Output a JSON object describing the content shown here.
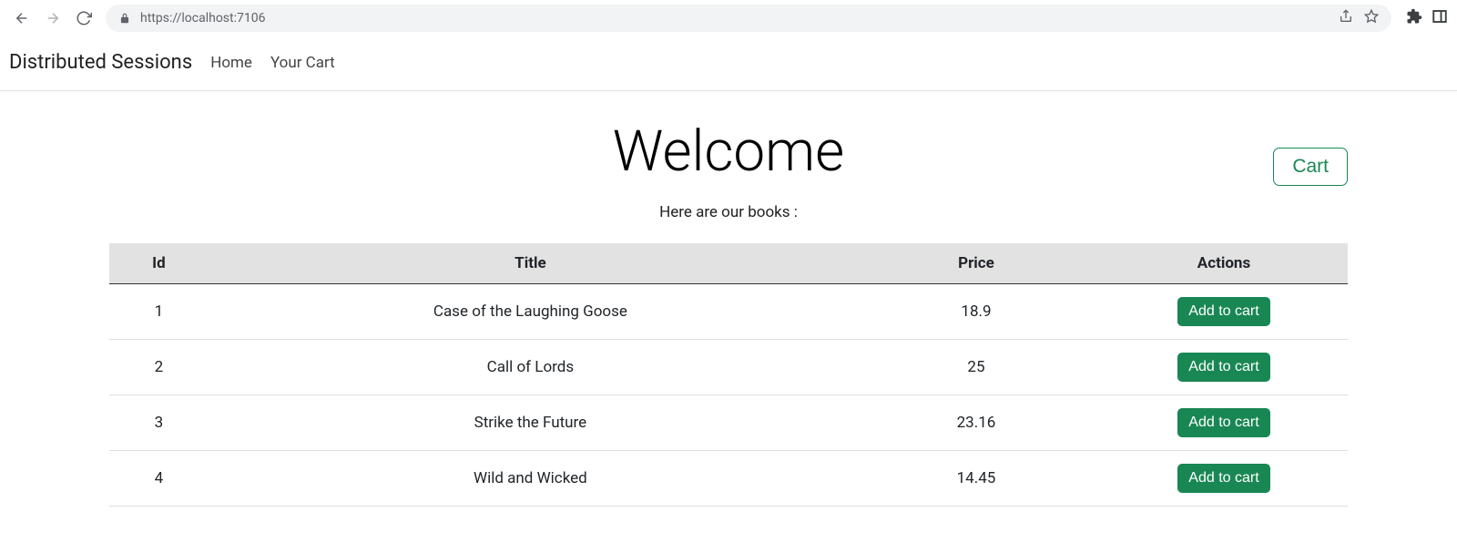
{
  "browser": {
    "url": "https://localhost:7106"
  },
  "navbar": {
    "brand": "Distributed Sessions",
    "links": {
      "home": "Home",
      "cart": "Your Cart"
    }
  },
  "hero": {
    "title": "Welcome",
    "subtitle": "Here are our books :",
    "cart_button": "Cart"
  },
  "table": {
    "headers": {
      "id": "Id",
      "title": "Title",
      "price": "Price",
      "actions": "Actions"
    },
    "action_label": "Add to cart",
    "rows": [
      {
        "id": "1",
        "title": "Case of the Laughing Goose",
        "price": "18.9"
      },
      {
        "id": "2",
        "title": "Call of Lords",
        "price": "25"
      },
      {
        "id": "3",
        "title": "Strike the Future",
        "price": "23.16"
      },
      {
        "id": "4",
        "title": "Wild and Wicked",
        "price": "14.45"
      }
    ]
  }
}
